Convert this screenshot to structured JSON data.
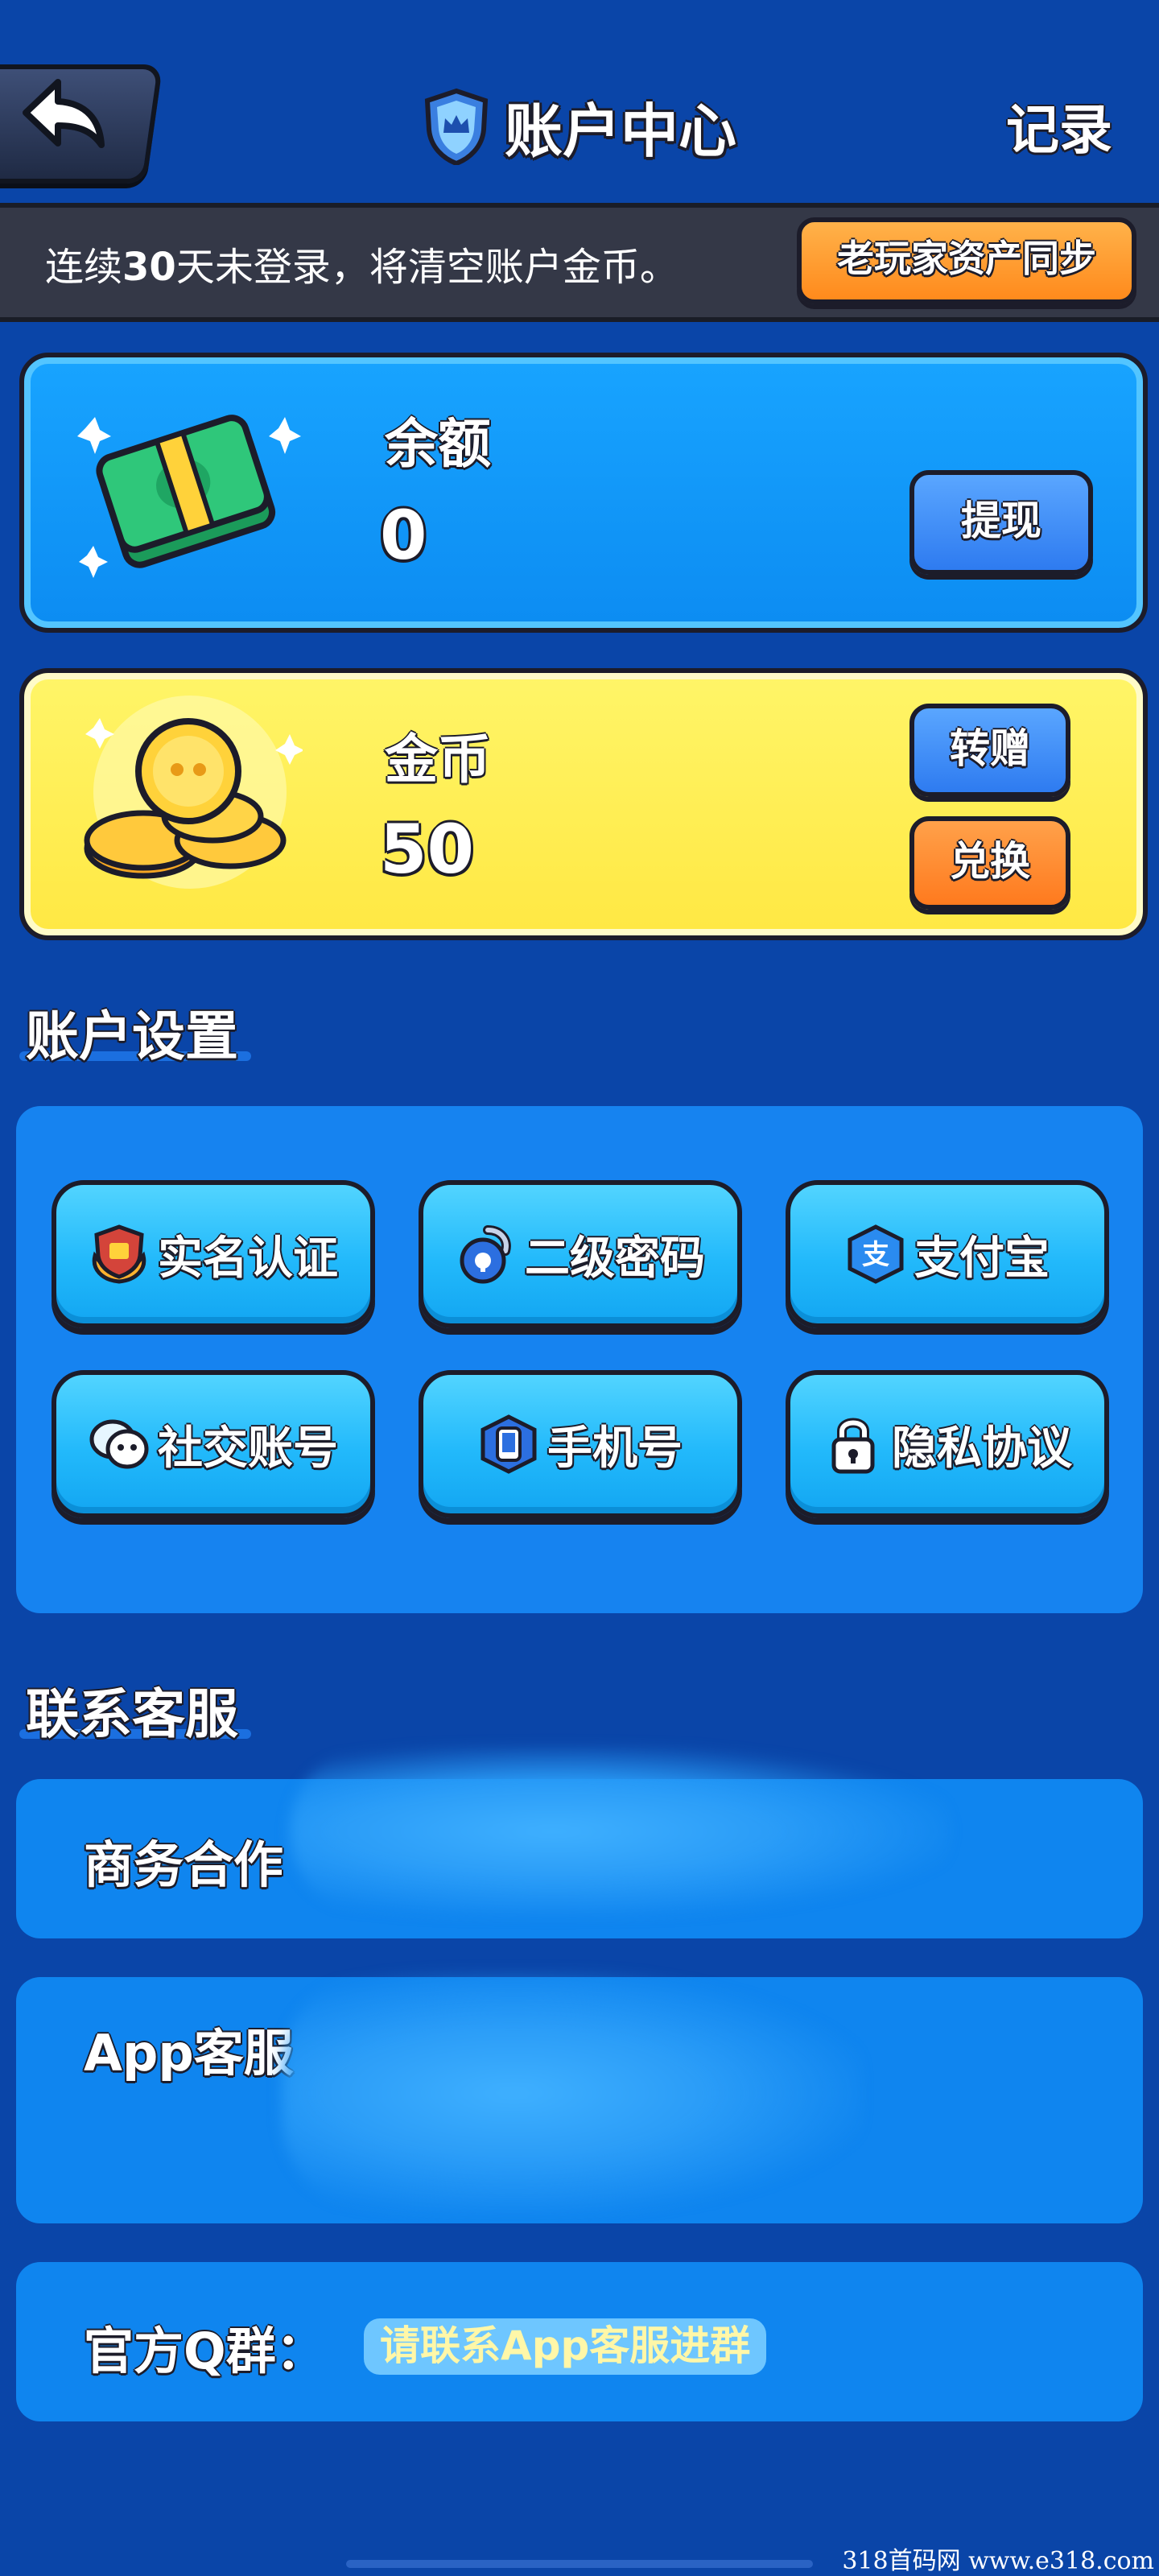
{
  "header": {
    "title": "账户中心",
    "records_label": "记录"
  },
  "notice": {
    "prefix": "连续",
    "days": "30",
    "suffix": "天未登录，将清空账户金币。",
    "sync_button": "老玩家资产同步"
  },
  "balance": {
    "label": "余额",
    "value": "0",
    "withdraw_button": "提现"
  },
  "coins": {
    "label": "金币",
    "value": "50",
    "transfer_button": "转赠",
    "exchange_button": "兑换"
  },
  "account_settings": {
    "title": "账户设置",
    "items": [
      {
        "label": "实名认证",
        "icon": "badge-icon"
      },
      {
        "label": "二级密码",
        "icon": "lock-icon"
      },
      {
        "label": "支付宝",
        "icon": "alipay-icon"
      },
      {
        "label": "社交账号",
        "icon": "chat-icon"
      },
      {
        "label": "手机号",
        "icon": "phone-icon"
      },
      {
        "label": "隐私协议",
        "icon": "padlock-icon"
      }
    ]
  },
  "contact": {
    "title": "联系客服",
    "business_label": "商务合作",
    "app_service_label": "App客服",
    "qq_group_label": "官方Q群：",
    "qq_group_value": "请联系App客服进群"
  },
  "watermark": "318首码网 www.e318.com",
  "colors": {
    "background": "#0a45a8",
    "balance_card": "#18a4ff",
    "coins_card": "#fff14f",
    "accent_orange": "#ff8a1c",
    "button_blue": "#2e7bf0",
    "setting_button": "#22b9fb"
  }
}
